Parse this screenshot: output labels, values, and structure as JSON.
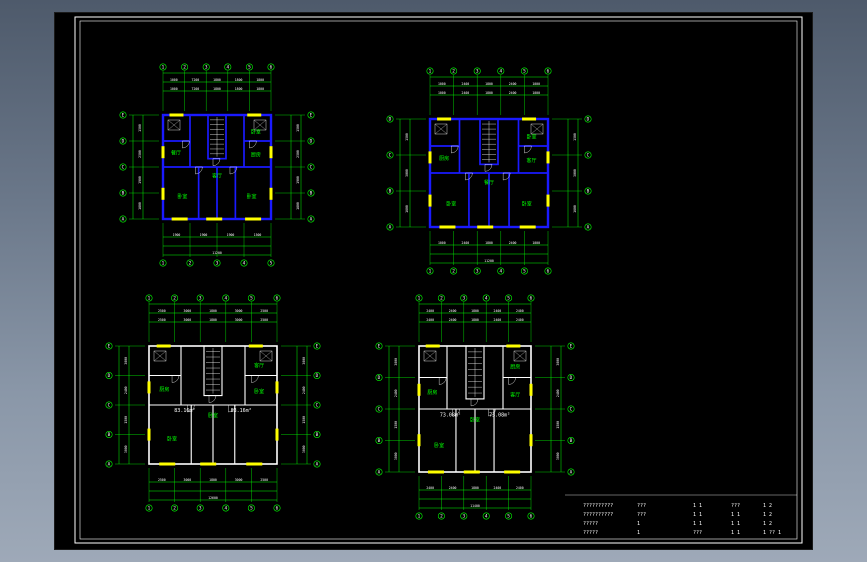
{
  "app": {
    "background_accent": "#000000"
  },
  "colors": {
    "frame": "#ffffff",
    "wall": "#1a1aff",
    "dim": "#00ff00",
    "text": "#ffffff",
    "window": "#ffff00"
  },
  "plans": [
    {
      "top_dims": [
        "1000",
        "7200",
        "1800",
        "1800",
        "1800"
      ],
      "bottom_dims": [
        "1900",
        "1900",
        "1900",
        "1500"
      ],
      "bottom_total": "11200",
      "left_dims": [
        "1500",
        "2500",
        "1900",
        "1800"
      ],
      "rooms": [
        "餐厅",
        "卧室",
        "厨房",
        "客厅",
        "卧室",
        "卧室"
      ],
      "area_labels": []
    },
    {
      "top_dims": [
        "1000",
        "2400",
        "1800",
        "2400",
        "1000"
      ],
      "bottom_dims": [
        "1000",
        "2400",
        "1800",
        "2400",
        "1000"
      ],
      "bottom_total": "11200",
      "left_dims": [
        "1500",
        "3000",
        "1600"
      ],
      "rooms": [
        "厨房",
        "卧室",
        "客厅",
        "餐厅",
        "卧室",
        "卧室"
      ],
      "area_labels": []
    },
    {
      "top_dims": [
        "2500",
        "3000",
        "1800",
        "3000",
        "2500"
      ],
      "bottom_dims": [
        "2500",
        "3000",
        "1800",
        "3000",
        "2500"
      ],
      "bottom_total": "12600",
      "left_dims": [
        "3000",
        "2400",
        "1500",
        "3000"
      ],
      "rooms": [
        "厨房",
        "客厅",
        "卧室",
        "卧室",
        "卧室"
      ],
      "area_labels": [
        "83.16m²",
        "83.16m²"
      ]
    },
    {
      "top_dims": [
        "2400",
        "2400",
        "1800",
        "2400",
        "2400"
      ],
      "bottom_dims": [
        "2400",
        "2400",
        "1800",
        "2400",
        "2400"
      ],
      "bottom_total": "11400",
      "left_dims": [
        "3000",
        "2400",
        "1500",
        "3000"
      ],
      "rooms": [
        "厨房",
        "厨房",
        "客厅",
        "卧室",
        "卧室"
      ],
      "area_labels": [
        "73.08m²",
        "73.08m²"
      ]
    }
  ],
  "title_block": {
    "rows": [
      [
        "??????????",
        "???",
        "1 1",
        "???",
        "1 2"
      ],
      [
        "??????????",
        "???",
        "1 1",
        "1 1",
        "1 2"
      ],
      [
        "?????",
        "1",
        "1 1",
        "1 1",
        "1 2"
      ],
      [
        "?????",
        "1",
        "???",
        "1 1",
        "1 ?? 1"
      ]
    ]
  }
}
